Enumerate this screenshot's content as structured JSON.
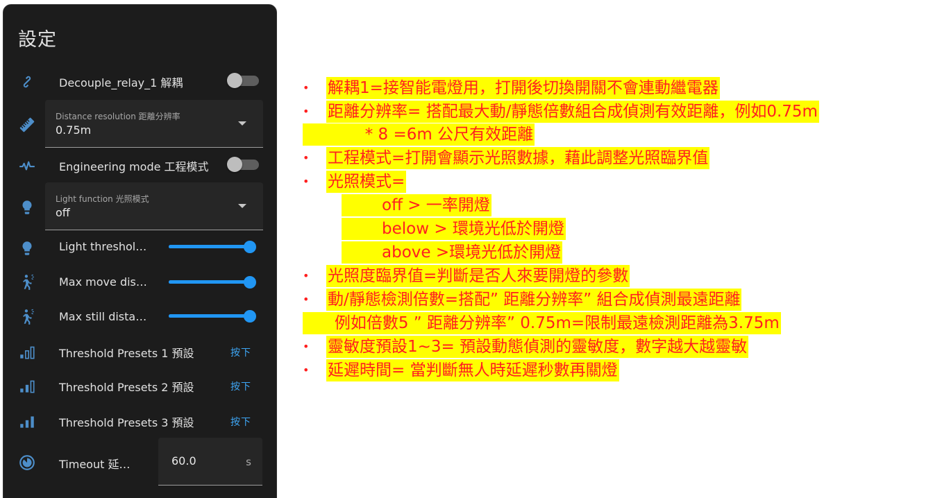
{
  "card": {
    "title": "設定",
    "rows": [
      {
        "kind": "toggle",
        "icon": "link-icon",
        "label": "Decouple_relay_1 解耦",
        "on": false
      },
      {
        "kind": "select",
        "icon": "ruler-icon",
        "label": "Distance resolution 距離分辨率",
        "value": "0.75m"
      },
      {
        "kind": "toggle",
        "icon": "pulse-icon",
        "label": "Engineering mode 工程模式",
        "on": false
      },
      {
        "kind": "select",
        "icon": "lightbulb-icon",
        "label": "Light function 光照模式",
        "value": "off"
      },
      {
        "kind": "slider",
        "icon": "lightbulb-icon",
        "label": "Light threshol…",
        "level": 1.0
      },
      {
        "kind": "slider",
        "icon": "motion-walk-icon",
        "label": "Max move dis…",
        "level": 1.0
      },
      {
        "kind": "slider",
        "icon": "motion-walk-icon",
        "label": "Max still dista…",
        "level": 1.0
      },
      {
        "kind": "button",
        "icon": "signal-1-icon",
        "label": "Threshold Presets 1 預設",
        "action": "按下"
      },
      {
        "kind": "button",
        "icon": "signal-2-icon",
        "label": "Threshold Presets 2 預設",
        "action": "按下"
      },
      {
        "kind": "button",
        "icon": "signal-3-icon",
        "label": "Threshold Presets 3 預設",
        "action": "按下"
      },
      {
        "kind": "number",
        "icon": "timer-icon",
        "label": "Timeout 延…",
        "value": "60.0",
        "unit": "s"
      }
    ]
  },
  "notes": [
    {
      "bullet": true,
      "indent": 0,
      "text": "解耦1=接智能電燈用，打開後切換開關不會連動繼電器"
    },
    {
      "bullet": true,
      "indent": 0,
      "text": "距離分辨率= 搭配最大動/靜態倍數組合成偵測有效距離，例如0.75m"
    },
    {
      "bullet": false,
      "indent": 0,
      "text": "            * 8 =6m 公尺有效距離"
    },
    {
      "bullet": true,
      "indent": 0,
      "text": "工程模式=打開會顯示光照數據，藉此調整光照臨界值"
    },
    {
      "bullet": true,
      "indent": 0,
      "text": "光照模式="
    },
    {
      "bullet": false,
      "indent": 1,
      "text": "off > 一率開燈"
    },
    {
      "bullet": false,
      "indent": 1,
      "text": "below > 環境光低於開燈"
    },
    {
      "bullet": false,
      "indent": 1,
      "text": "above >環境光低於開燈"
    },
    {
      "bullet": true,
      "indent": 0,
      "text": "光照度臨界值=判斷是否人來要開燈的參數"
    },
    {
      "bullet": true,
      "indent": 0,
      "text": "動/靜態檢測倍數=搭配” 距離分辨率” 組合成偵測最遠距離"
    },
    {
      "bullet": false,
      "indent": 0,
      "text": "      例如倍數5 ” 距離分辨率” 0.75m=限制最遠檢測距離為3.75m"
    },
    {
      "bullet": true,
      "indent": 0,
      "text": "靈敏度預設1~3= 預設動態偵測的靈敏度，數字越大越靈敏"
    },
    {
      "bullet": true,
      "indent": 0,
      "text": "延遲時間= 當判斷無人時延遲秒數再關燈"
    }
  ],
  "colors": {
    "card_bg": "#1c1c1c",
    "accent": "#2196f3",
    "icon": "#4d8ec9",
    "note_text": "#ff1f1f",
    "note_highlight": "#ffff00"
  }
}
